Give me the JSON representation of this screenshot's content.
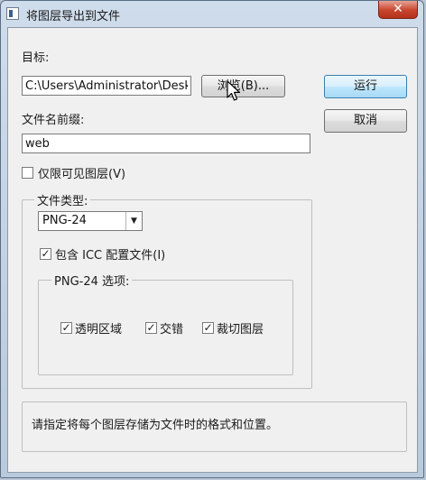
{
  "window": {
    "title": "将图层导出到文件",
    "close_symbol": "✕"
  },
  "target": {
    "label": "目标:",
    "value": "C:\\Users\\Administrator\\Desk",
    "browse_label": "浏览(B)..."
  },
  "actions": {
    "run_label": "运行",
    "cancel_label": "取消"
  },
  "prefix": {
    "label": "文件名前缀:",
    "value": "web"
  },
  "visible_only": {
    "label": "仅限可见图层(V)",
    "checked": false
  },
  "file_type": {
    "group_label": "文件类型:",
    "selected": "PNG-24",
    "icc_label": "包含 ICC 配置文件(I)",
    "icc_checked": true
  },
  "png_options": {
    "group_label": "PNG-24 选项:",
    "transparency_label": "透明区域",
    "transparency_checked": true,
    "interlaced_label": "交错",
    "interlaced_checked": true,
    "trim_label": "裁切图层",
    "trim_checked": true
  },
  "description": {
    "text": "请指定将每个图层存储为文件时的格式和位置。"
  },
  "check_mark": "✓"
}
